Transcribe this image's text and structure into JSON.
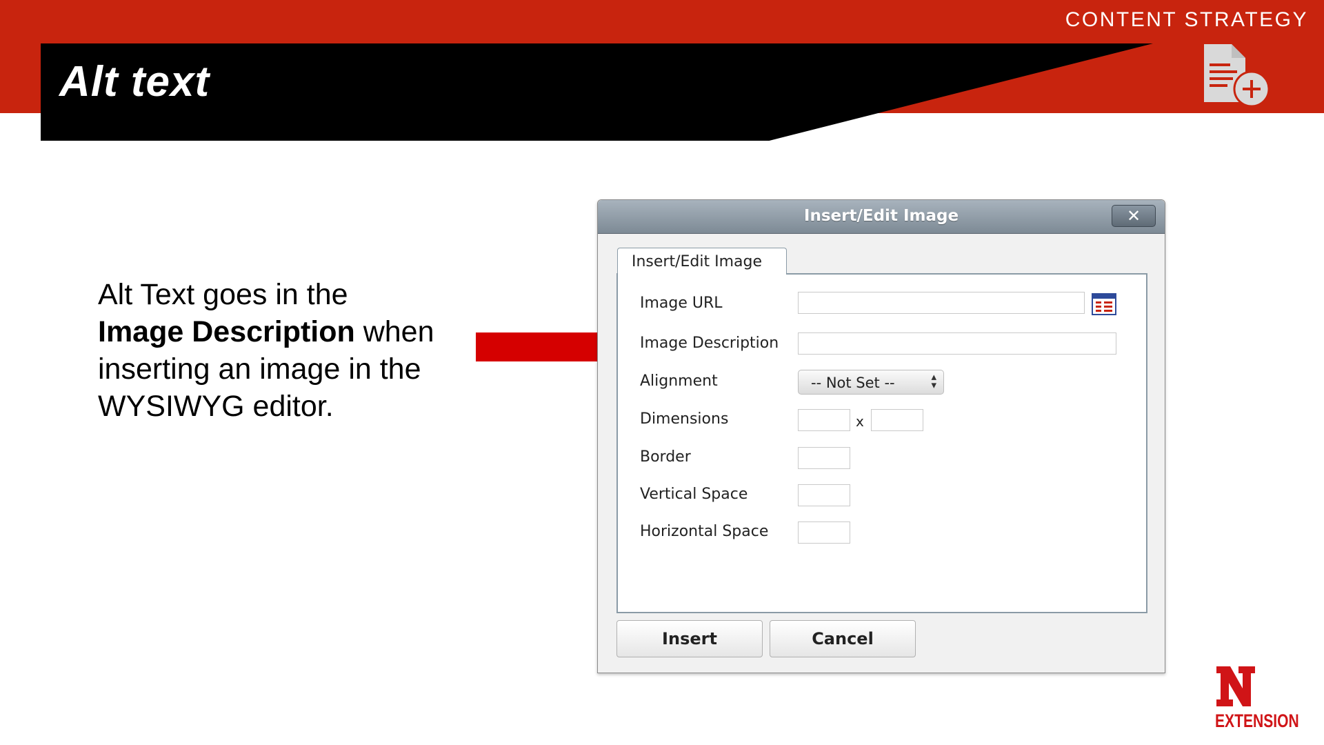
{
  "header": {
    "title": "Alt text",
    "section_label": "CONTENT STRATEGY",
    "icon": "document-add-icon",
    "brand_color": "#c8240e"
  },
  "body": {
    "line1": "Alt Text goes in the",
    "emphasis": "Image Description",
    "line2_rest": " when",
    "line3": "inserting an image in the",
    "line4": "WYSIWYG editor."
  },
  "arrow": {
    "color": "#d50000"
  },
  "dialog": {
    "title": "Insert/Edit Image",
    "close_label": "✕",
    "tab_label": "Insert/Edit Image",
    "fields": {
      "image_url_label": "Image URL",
      "image_description_label": "Image Description",
      "alignment_label": "Alignment",
      "alignment_value": "-- Not Set --",
      "dimensions_label": "Dimensions",
      "dimensions_sep": "x",
      "border_label": "Border",
      "vertical_space_label": "Vertical Space",
      "horizontal_space_label": "Horizontal Space"
    },
    "insert_label": "Insert",
    "cancel_label": "Cancel"
  },
  "logo": {
    "letter": "N",
    "text": "EXTENSION",
    "color": "#d01417"
  }
}
